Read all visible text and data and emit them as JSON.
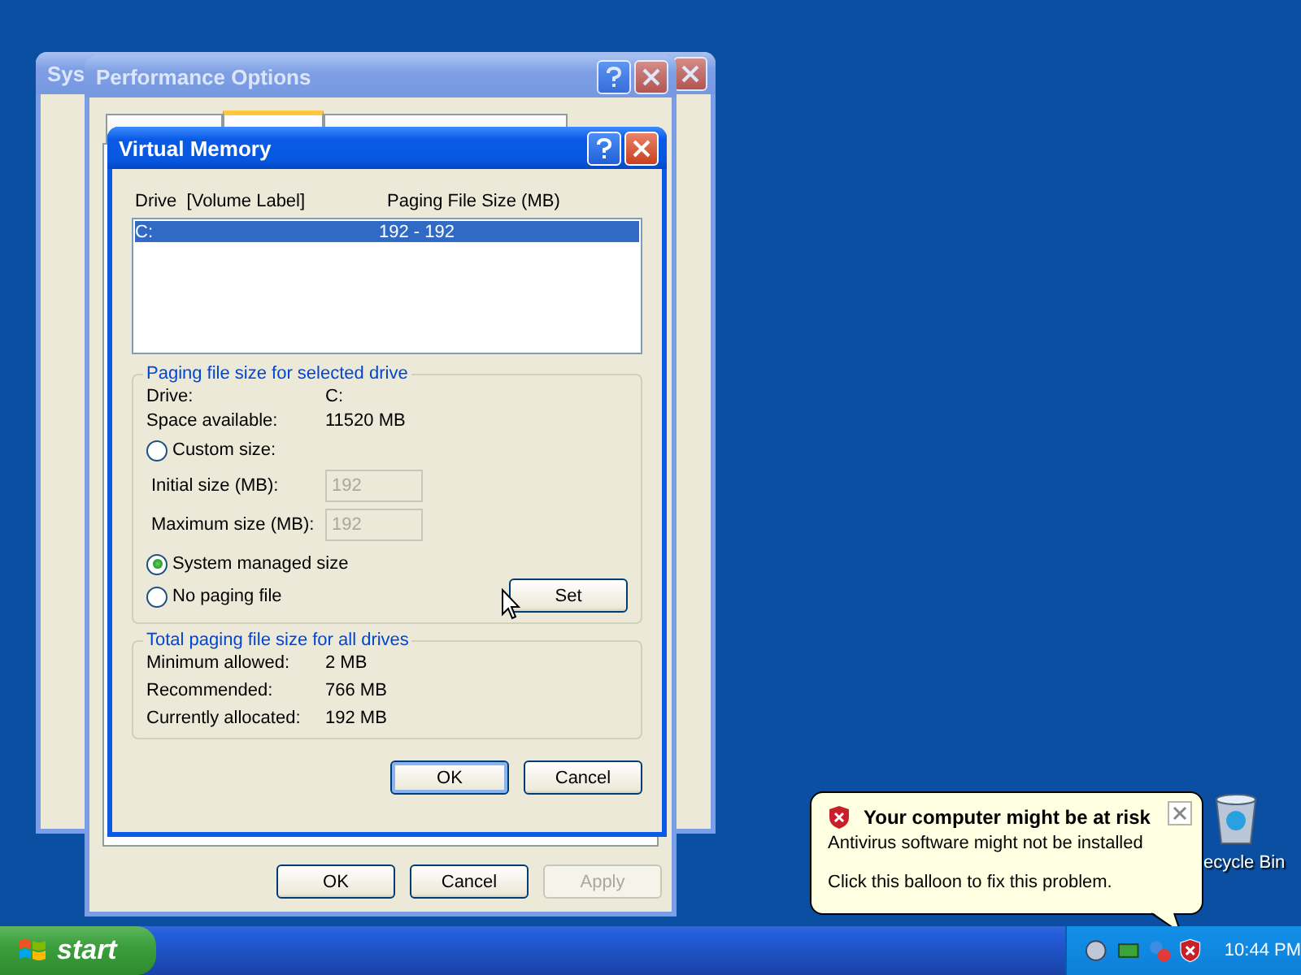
{
  "system_properties": {
    "title": "Sys"
  },
  "performance_options": {
    "title": "Performance Options",
    "tabs": [
      {
        "selected": false
      },
      {
        "selected": true
      },
      {
        "selected": false
      }
    ],
    "buttons": [
      {
        "label": "OK",
        "disabled": false
      },
      {
        "label": "Cancel",
        "disabled": false
      },
      {
        "label": "Apply",
        "disabled": true
      }
    ]
  },
  "virtual_memory": {
    "title": "Virtual Memory",
    "columns": [
      "Drive  [Volume Label]",
      "Paging File Size (MB)"
    ],
    "drives": [
      {
        "drive": "C:",
        "size": "192 - 192",
        "selected": true
      }
    ],
    "selected_drive": {
      "legend": "Paging file size for selected drive",
      "rows": [
        {
          "label": "Drive:",
          "value": "C:"
        },
        {
          "label": "Space available:",
          "value": "11520 MB"
        }
      ],
      "options": [
        {
          "label": "Custom size:",
          "selected": false
        },
        {
          "label": "System managed size",
          "selected": true
        },
        {
          "label": "No paging file",
          "selected": false
        }
      ],
      "fields": [
        {
          "label": "Initial size (MB):",
          "value": "192",
          "disabled": true
        },
        {
          "label": "Maximum size (MB):",
          "value": "192",
          "disabled": true
        }
      ],
      "set_button": "Set"
    },
    "totals": {
      "legend": "Total paging file size for all drives",
      "rows": [
        {
          "label": "Minimum allowed:",
          "value": "2 MB"
        },
        {
          "label": "Recommended:",
          "value": "766 MB"
        },
        {
          "label": "Currently allocated:",
          "value": "192 MB"
        }
      ]
    },
    "buttons": [
      {
        "label": "OK",
        "default": true
      },
      {
        "label": "Cancel",
        "default": false
      }
    ]
  },
  "balloon": {
    "title": "Your computer might be at risk",
    "lines": [
      "Antivirus software might not be installed",
      "Click this balloon to fix this problem."
    ]
  },
  "desktop_icons": [
    {
      "label": "ecycle Bin"
    }
  ],
  "taskbar": {
    "start": "start",
    "clock": "10:44 PM"
  }
}
